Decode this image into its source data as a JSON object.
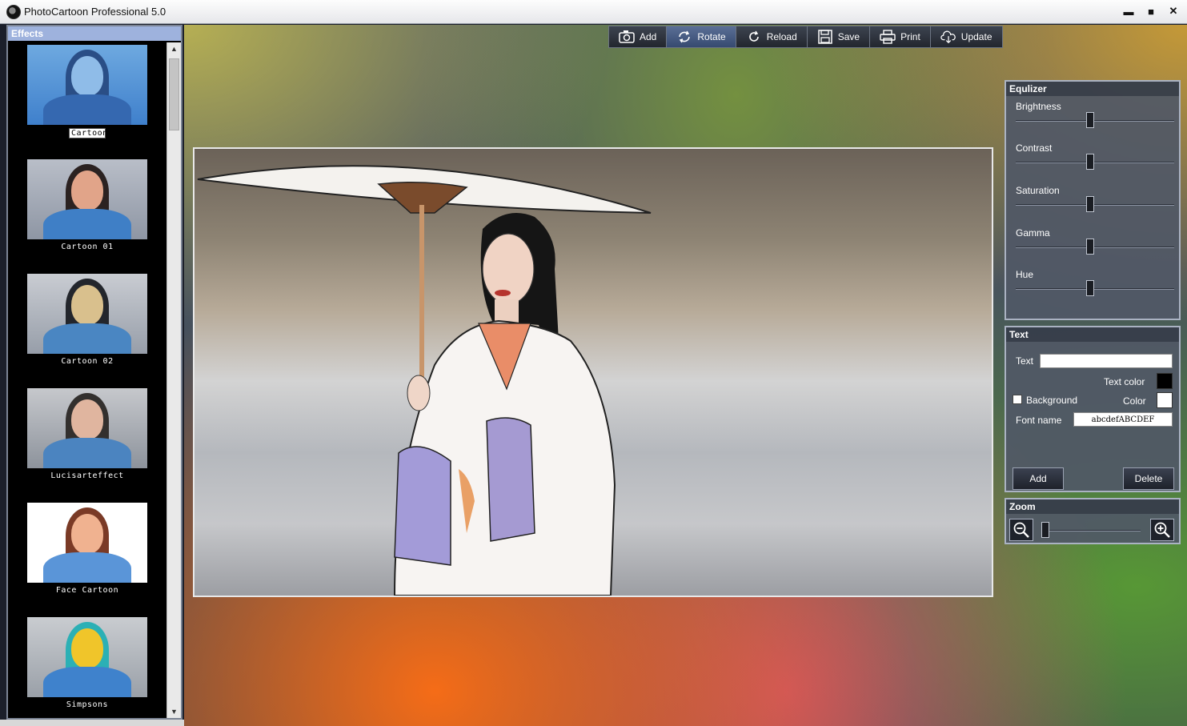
{
  "window": {
    "title": "PhotoCartoon Professional 5.0",
    "minimize": "▬",
    "maximize": "■",
    "close": "✕"
  },
  "effects": {
    "header": "Effects",
    "items": [
      {
        "label": "Cartoon",
        "selected": true
      },
      {
        "label": "Cartoon 01",
        "selected": false
      },
      {
        "label": "Cartoon 02",
        "selected": false
      },
      {
        "label": "Lucisarteffect",
        "selected": false
      },
      {
        "label": "Face Cartoon",
        "selected": false
      },
      {
        "label": "Simpsons",
        "selected": false
      }
    ],
    "scroll_up": "▲",
    "scroll_down": "▼"
  },
  "toolbar": {
    "add": "Add",
    "rotate": "Rotate",
    "reload": "Reload",
    "save": "Save",
    "print": "Print",
    "update": "Update"
  },
  "equalizer": {
    "title": "Equlizer",
    "sliders": [
      {
        "label": "Brightness",
        "value": 0.47
      },
      {
        "label": "Contrast",
        "value": 0.47
      },
      {
        "label": "Saturation",
        "value": 0.47
      },
      {
        "label": "Gamma",
        "value": 0.47
      },
      {
        "label": "Hue",
        "value": 0.47
      }
    ]
  },
  "text_panel": {
    "title": "Text",
    "text_label": "Text",
    "text_value": "",
    "text_color_label": "Text color",
    "text_color": "#000000",
    "background_label": "Background",
    "background_checked": false,
    "color_label": "Color",
    "bg_color": "#ffffff",
    "font_name_label": "Font name",
    "font_name_value": "abcdefABCDEF",
    "add_button": "Add",
    "delete_button": "Delete"
  },
  "zoom": {
    "title": "Zoom",
    "value": 0.0
  },
  "colors": {
    "panel_bg": "#505866",
    "effects_header": "#9eb2dd",
    "active_tool": "#4a5f86"
  }
}
